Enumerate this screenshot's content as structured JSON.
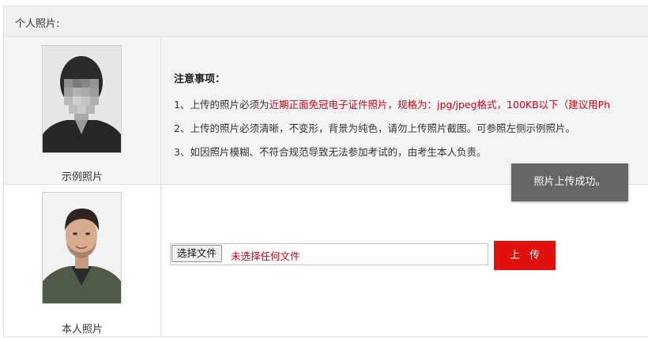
{
  "section": {
    "label": "个人照片:"
  },
  "example": {
    "caption": "示例照片"
  },
  "own": {
    "caption": "本人照片"
  },
  "notes": {
    "title": "注意事项：",
    "line1_prefix": "1、上传的照片必须为",
    "line1_highlight": "近期正面免冠电子证件照片，规格为：jpg/jpeg格式，100KB以下（建议用Ph",
    "line2": "2、上传的照片必须清晰，不变形，背景为纯色，请勿上传照片截图。可参照左侧示例照片。",
    "line3": "3、如因照片模糊、不符合规范导致无法参加考试的，由考生本人负责。"
  },
  "toast": {
    "message": "照片上传成功。"
  },
  "file_input": {
    "button_label": "选择文件",
    "status": "未选择任何文件"
  },
  "upload_button": {
    "label": "上传"
  },
  "colors": {
    "accent_red": "#e0100c",
    "warning_red": "#d0021b",
    "toast_bg": "#666666"
  }
}
